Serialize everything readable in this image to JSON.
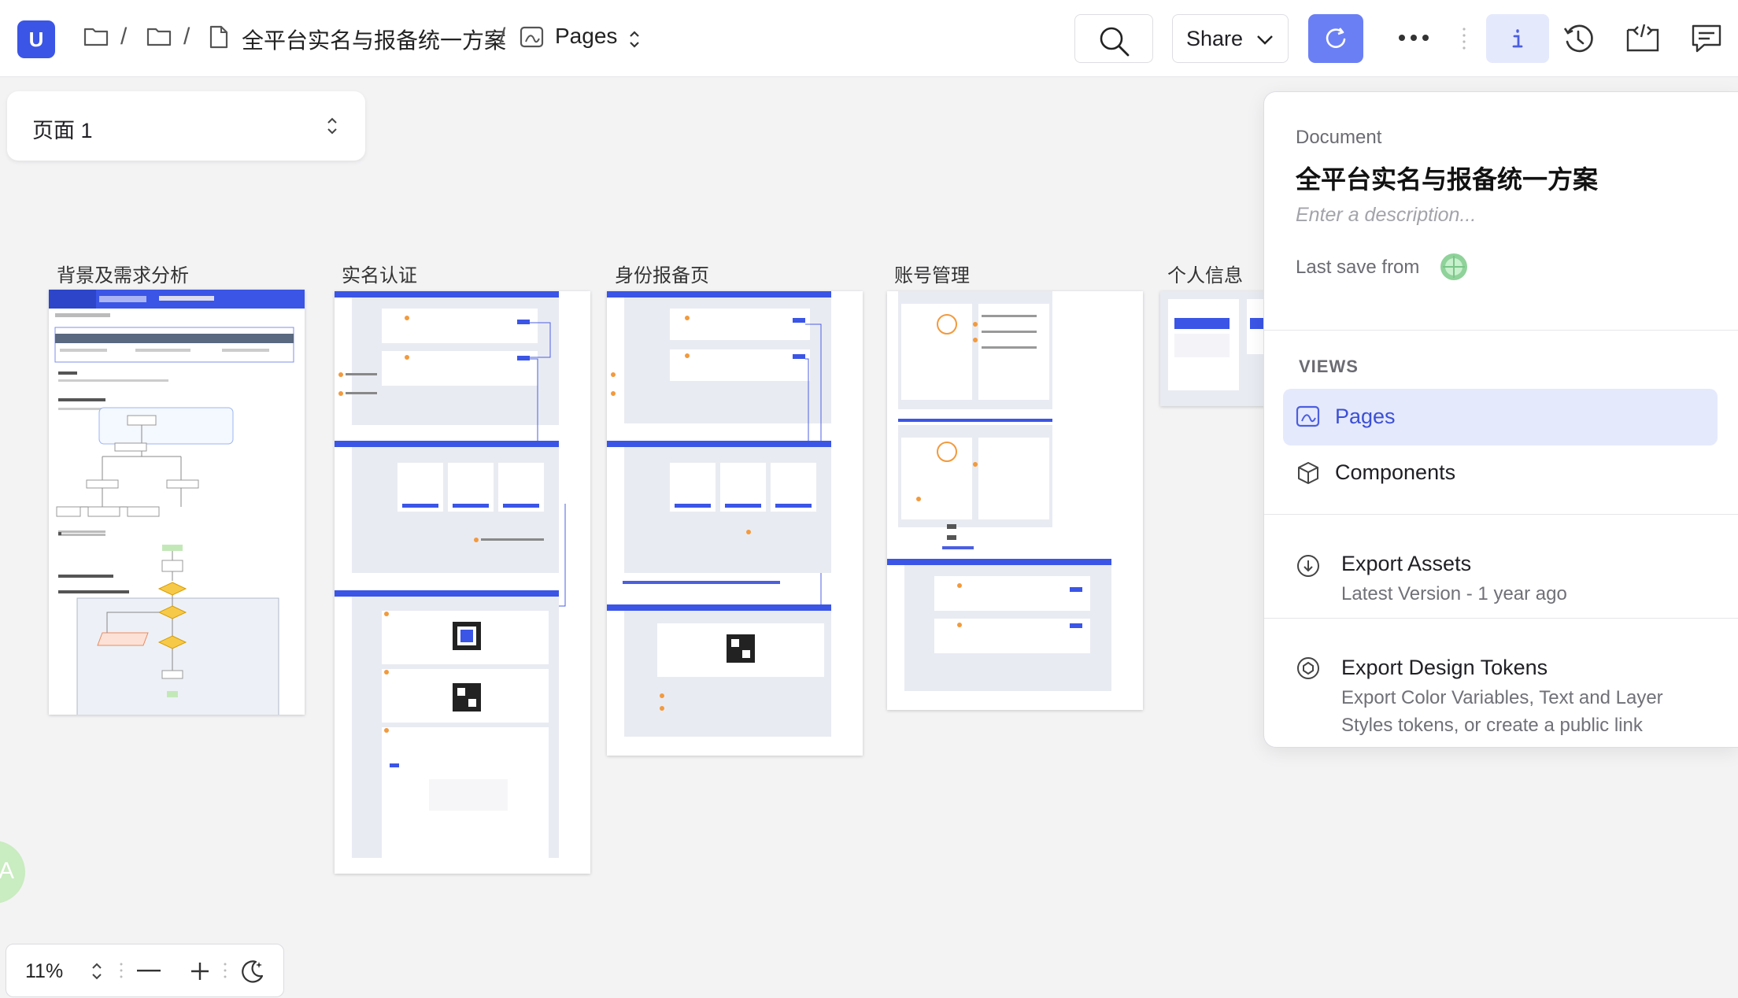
{
  "colors": {
    "accent": "#3b55e6",
    "accent_light": "#6b7ff5",
    "active_bg": "#e5e9fc",
    "annotation_orange": "#f29a3d"
  },
  "header": {
    "logo_letter": "U",
    "breadcrumb": {
      "separator": "/",
      "document_title": "全平台实名与报备统一方案",
      "current_view": "Pages"
    },
    "share_label": "Share",
    "icons": [
      "search-icon",
      "refresh-icon",
      "more-icon",
      "info-icon",
      "history-icon",
      "code-icon",
      "comment-icon"
    ]
  },
  "page_selector": {
    "label": "页面 1"
  },
  "boards": [
    {
      "title": "背景及需求分析"
    },
    {
      "title": "实名认证"
    },
    {
      "title": "身份报备页"
    },
    {
      "title": "账号管理"
    },
    {
      "title": "个人信息"
    }
  ],
  "zoom": {
    "level": "11%"
  },
  "avatar": {
    "letter": "A"
  },
  "panel": {
    "section_label": "Document",
    "document_title": "全平台实名与报备统一方案",
    "description_placeholder": "Enter a description...",
    "last_save_label": "Last save from",
    "views_heading": "VIEWS",
    "views": [
      {
        "label": "Pages",
        "active": true
      },
      {
        "label": "Components",
        "active": false
      }
    ],
    "export_assets": {
      "title": "Export Assets",
      "subtitle": "Latest Version - 1 year ago"
    },
    "export_tokens": {
      "title": "Export Design Tokens",
      "subtitle_line1": "Export Color Variables, Text and Layer",
      "subtitle_line2": "Styles tokens, or create a public link"
    }
  }
}
